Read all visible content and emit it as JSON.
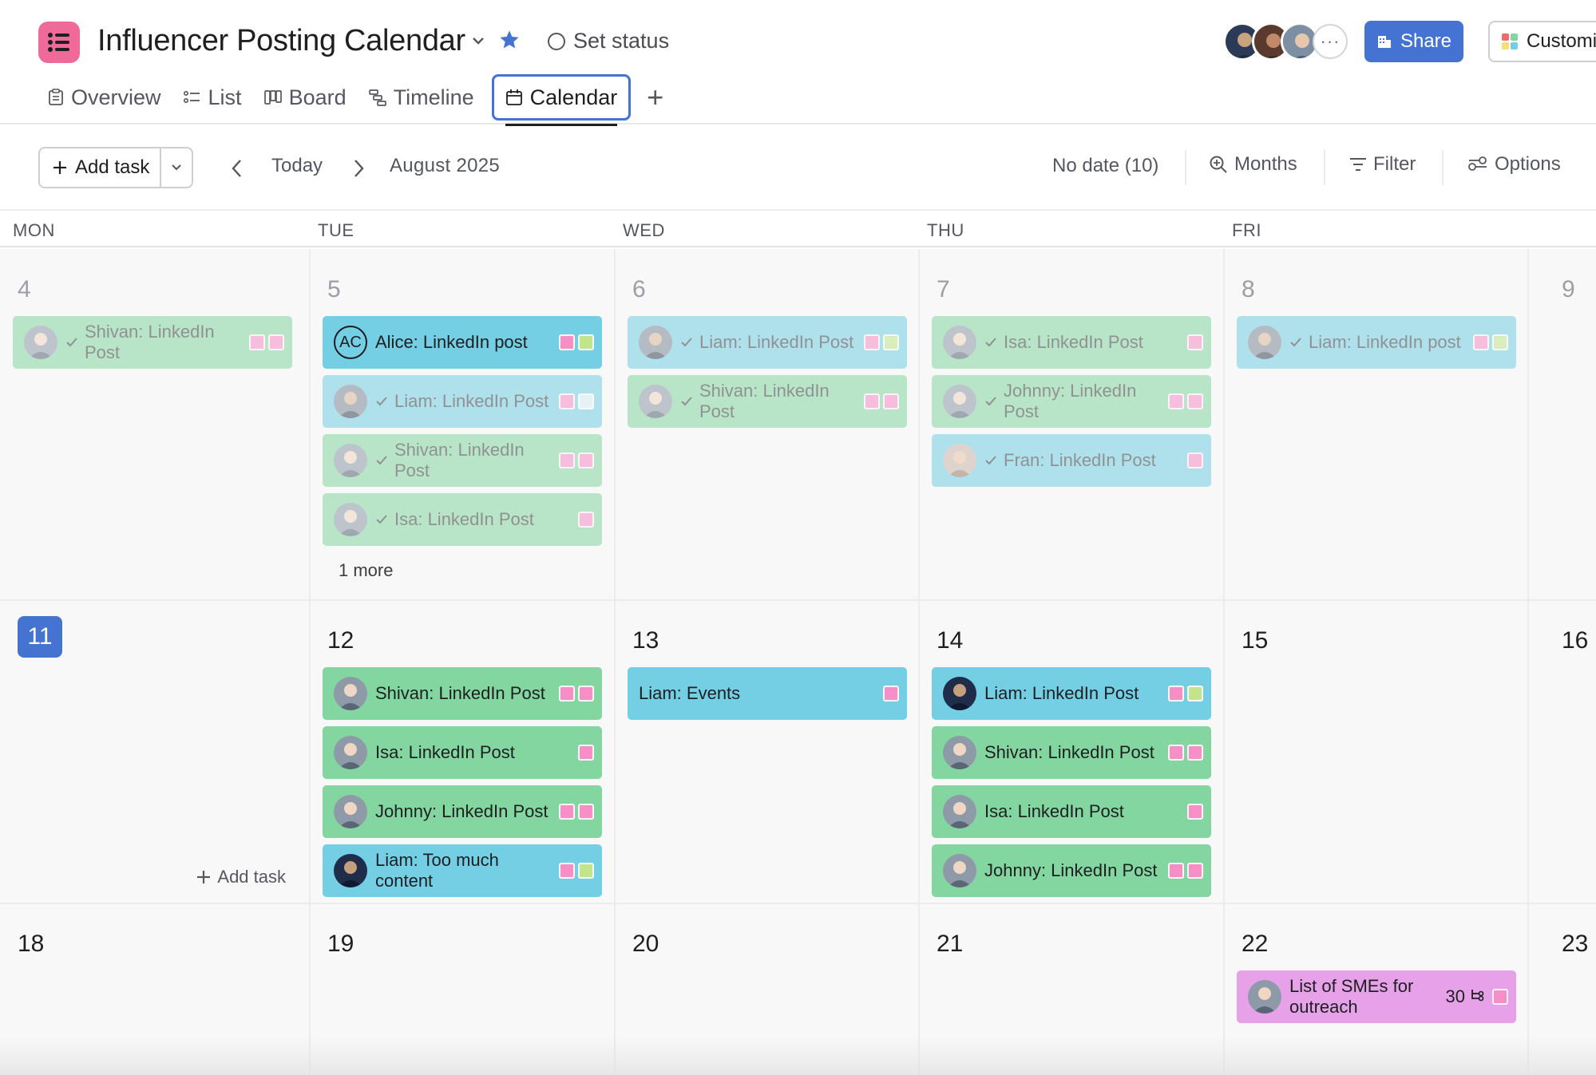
{
  "header": {
    "title": "Influencer Posting Calendar",
    "set_status": "Set status",
    "share_label": "Share",
    "customize_label": "Customi",
    "avatar_more": "···",
    "accent": "#4573d2",
    "icon_color": "#f06a99"
  },
  "tabs": [
    {
      "label": "Overview",
      "icon": "overview-icon"
    },
    {
      "label": "List",
      "icon": "list-icon"
    },
    {
      "label": "Board",
      "icon": "board-icon"
    },
    {
      "label": "Timeline",
      "icon": "timeline-icon"
    },
    {
      "label": "Calendar",
      "icon": "calendar-icon",
      "active": true
    }
  ],
  "toolbar": {
    "add_task": "Add task",
    "today": "Today",
    "month": "August 2025",
    "no_date": "No date (10)",
    "months": "Months",
    "filter": "Filter",
    "options": "Options"
  },
  "day_headers": [
    "MON",
    "TUE",
    "WED",
    "THU",
    "FRI"
  ],
  "weeks": [
    {
      "days": [
        {
          "date": "4",
          "state": "past",
          "tasks": [
            {
              "name": "Shivan: LinkedIn Post",
              "color": "green",
              "done": true,
              "avatar": "shivan",
              "tags": [
                "pk",
                "pk"
              ]
            }
          ]
        },
        {
          "date": "5",
          "state": "past",
          "more": "1 more",
          "tasks": [
            {
              "name": "Alice: LinkedIn post",
              "color": "blue",
              "done": false,
              "avatar": "AC",
              "tags": [
                "pk",
                "lg"
              ]
            },
            {
              "name": "Liam: LinkedIn Post",
              "color": "blue",
              "done": true,
              "avatar": "liam",
              "tags": [
                "pk",
                "lb"
              ]
            },
            {
              "name": "Shivan: LinkedIn Post",
              "color": "green",
              "done": true,
              "avatar": "shivan",
              "tags": [
                "pk",
                "pk"
              ]
            },
            {
              "name": "Isa: LinkedIn Post",
              "color": "green",
              "done": true,
              "avatar": "shivan",
              "tags": [
                "pk"
              ]
            }
          ]
        },
        {
          "date": "6",
          "state": "past",
          "tasks": [
            {
              "name": "Liam: LinkedIn Post",
              "color": "blue",
              "done": true,
              "avatar": "liam",
              "tags": [
                "pk",
                "lg"
              ]
            },
            {
              "name": "Shivan: LinkedIn Post",
              "color": "green",
              "done": true,
              "avatar": "shivan",
              "tags": [
                "pk",
                "pk"
              ]
            }
          ]
        },
        {
          "date": "7",
          "state": "past",
          "tasks": [
            {
              "name": "Isa: LinkedIn Post",
              "color": "green",
              "done": true,
              "avatar": "shivan",
              "tags": [
                "pk"
              ]
            },
            {
              "name": "Johnny: LinkedIn Post",
              "color": "green",
              "done": true,
              "avatar": "shivan",
              "tags": [
                "pk",
                "pk"
              ]
            },
            {
              "name": "Fran: LinkedIn Post",
              "color": "blue",
              "done": true,
              "avatar": "fran",
              "tags": [
                "pk"
              ]
            }
          ]
        },
        {
          "date": "8",
          "state": "past",
          "tasks": [
            {
              "name": "Liam: LinkedIn post",
              "color": "blue",
              "done": true,
              "avatar": "liam",
              "tags": [
                "pk",
                "lg"
              ]
            }
          ]
        },
        {
          "date": "9",
          "state": "past",
          "tasks": []
        }
      ]
    },
    {
      "days": [
        {
          "date": "11",
          "state": "today",
          "add_task": "Add task",
          "tasks": []
        },
        {
          "date": "12",
          "state": "normal",
          "tasks": [
            {
              "name": "Shivan: LinkedIn Post",
              "color": "green",
              "done": false,
              "avatar": "shivan",
              "tags": [
                "pk",
                "pk"
              ]
            },
            {
              "name": "Isa: LinkedIn Post",
              "color": "green",
              "done": false,
              "avatar": "shivan",
              "tags": [
                "pk"
              ]
            },
            {
              "name": "Johnny: LinkedIn Post",
              "color": "green",
              "done": false,
              "avatar": "shivan",
              "tags": [
                "pk",
                "pk"
              ]
            },
            {
              "name": "Liam: Too much content",
              "color": "blue",
              "done": false,
              "avatar": "liamdark",
              "tags": [
                "pk",
                "lg"
              ]
            }
          ]
        },
        {
          "date": "13",
          "state": "normal",
          "tasks": [
            {
              "name": "Liam: Events",
              "color": "blue",
              "done": false,
              "avatar": "",
              "tags": [
                "pk"
              ]
            }
          ]
        },
        {
          "date": "14",
          "state": "normal",
          "tasks": [
            {
              "name": "Liam: LinkedIn Post",
              "color": "blue",
              "done": false,
              "avatar": "liamdark",
              "tags": [
                "pk",
                "lg"
              ]
            },
            {
              "name": "Shivan: LinkedIn Post",
              "color": "green",
              "done": false,
              "avatar": "shivan",
              "tags": [
                "pk",
                "pk"
              ]
            },
            {
              "name": "Isa: LinkedIn Post",
              "color": "green",
              "done": false,
              "avatar": "shivan",
              "tags": [
                "pk"
              ]
            },
            {
              "name": "Johnny: LinkedIn Post",
              "color": "green",
              "done": false,
              "avatar": "shivan",
              "tags": [
                "pk",
                "pk"
              ]
            }
          ]
        },
        {
          "date": "15",
          "state": "normal",
          "tasks": []
        },
        {
          "date": "16",
          "state": "normal",
          "tasks": []
        }
      ]
    },
    {
      "days": [
        {
          "date": "18",
          "state": "normal",
          "tasks": []
        },
        {
          "date": "19",
          "state": "normal",
          "tasks": []
        },
        {
          "date": "20",
          "state": "normal",
          "tasks": []
        },
        {
          "date": "21",
          "state": "normal",
          "tasks": []
        },
        {
          "date": "22",
          "state": "normal",
          "tasks": [
            {
              "name": "List of SMEs for outreach",
              "color": "pink",
              "done": false,
              "avatar": "shivan",
              "tags": [
                "pk"
              ],
              "subtasks": "30"
            }
          ]
        },
        {
          "date": "23",
          "state": "normal",
          "tasks": []
        }
      ]
    }
  ]
}
